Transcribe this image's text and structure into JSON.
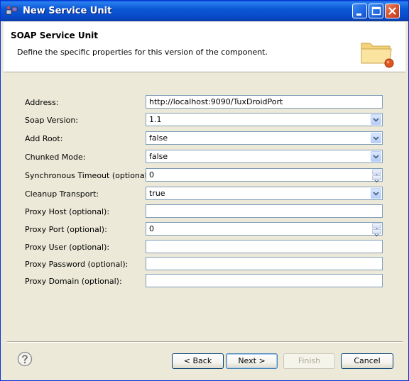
{
  "window": {
    "title": "New Service Unit"
  },
  "header": {
    "title": "SOAP Service Unit",
    "description": "Define the specific properties for this version of the component."
  },
  "form": {
    "address_label": "Address:",
    "address_value": "http://localhost:9090/TuxDroidPort",
    "soap_version_label": "Soap Version:",
    "soap_version_value": "1.1",
    "add_root_label": "Add Root:",
    "add_root_value": "false",
    "chunked_mode_label": "Chunked Mode:",
    "chunked_mode_value": "false",
    "sync_timeout_label": "Synchronous Timeout (optional):",
    "sync_timeout_value": "0",
    "cleanup_transport_label": "Cleanup Transport:",
    "cleanup_transport_value": "true",
    "proxy_host_label": "Proxy Host (optional):",
    "proxy_host_value": "",
    "proxy_port_label": "Proxy Port (optional):",
    "proxy_port_value": "0",
    "proxy_user_label": "Proxy User (optional):",
    "proxy_user_value": "",
    "proxy_password_label": "Proxy Password (optional):",
    "proxy_password_value": "",
    "proxy_domain_label": "Proxy Domain (optional):",
    "proxy_domain_value": ""
  },
  "buttons": {
    "back": "< Back",
    "next": "Next >",
    "finish": "Finish",
    "cancel": "Cancel"
  },
  "icons": {
    "title": "wizard-icon",
    "header": "folder-icon",
    "help": "help-icon"
  }
}
